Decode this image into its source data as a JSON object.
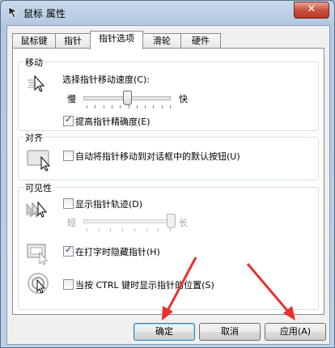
{
  "window": {
    "title": "鼠标 属性",
    "close_glyph": "✕"
  },
  "tabs": [
    {
      "label": "鼠标键"
    },
    {
      "label": "指针"
    },
    {
      "label": "指针选项"
    },
    {
      "label": "滑轮"
    },
    {
      "label": "硬件"
    }
  ],
  "motion": {
    "group_title": "移动",
    "speed_label": "选择指针移动速度(C):",
    "slow": "慢",
    "fast": "快",
    "speed_value": 6,
    "speed_max": 11,
    "enhance_label": "提高指针精确度(E)",
    "enhance_checked": true
  },
  "snap": {
    "group_title": "对齐",
    "snap_label": "自动将指针移动到对话框中的默认按钮(U)",
    "snap_checked": false
  },
  "visibility": {
    "group_title": "可见性",
    "trails_label": "显示指针轨迹(D)",
    "trails_checked": false,
    "short": "短",
    "long": "长",
    "trail_value": 1.0,
    "hide_label": "在打字时隐藏指针(H)",
    "hide_checked": true,
    "ctrl_label": "当按 CTRL 键时显示指针的位置(S)",
    "ctrl_checked": false
  },
  "buttons": {
    "ok": "确定",
    "cancel": "取消",
    "apply": "应用(A)"
  },
  "annotation_color": "#e8312f"
}
